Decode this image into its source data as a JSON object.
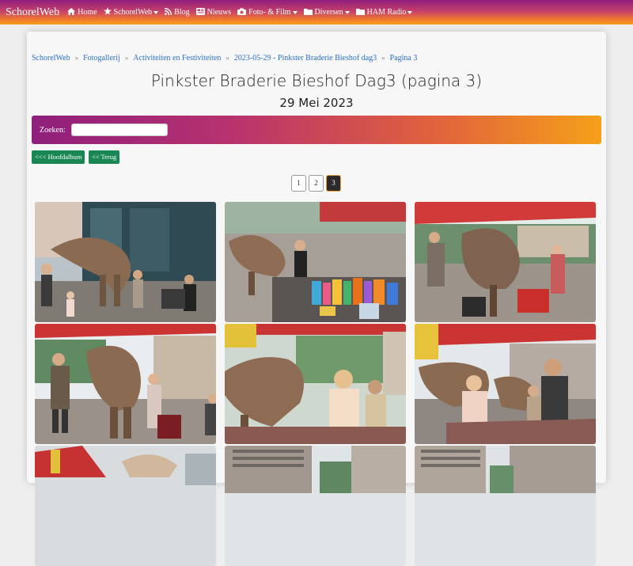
{
  "navbar": {
    "brand": "SchorelWeb",
    "items": [
      {
        "label": "Home",
        "icon": "home-icon",
        "dropdown": false
      },
      {
        "label": "SchorelWeb",
        "icon": "star-icon",
        "dropdown": true
      },
      {
        "label": "Blog",
        "icon": "rss-icon",
        "dropdown": false
      },
      {
        "label": "Nieuws",
        "icon": "newspaper-icon",
        "dropdown": false
      },
      {
        "label": "Foto- & Film",
        "icon": "camera-icon",
        "dropdown": true
      },
      {
        "label": "Diversen",
        "icon": "folder-icon",
        "dropdown": true
      },
      {
        "label": "HAM Radio",
        "icon": "folder-icon",
        "dropdown": true
      }
    ]
  },
  "breadcrumb": [
    "SchorelWeb",
    "Fotogallerij",
    "Activiteiten en Festiviteiten",
    "2023-05-29 - Pinkster Braderie Bieshof dag3",
    "Pagina 3"
  ],
  "page": {
    "title": "Pinkster Braderie Bieshof Dag3 (pagina 3)",
    "subtitle": "29 Mei 2023"
  },
  "search": {
    "label": "Zoeken:",
    "value": "",
    "placeholder": ""
  },
  "buttons": {
    "main_album": "<<< Hoofdalbum",
    "back": "<< Terug"
  },
  "pagination": {
    "pages": [
      "1",
      "2",
      "3"
    ],
    "current": "3"
  },
  "gallery": {
    "photos": [
      {
        "subject": "dinosaur-costume-crowd"
      },
      {
        "subject": "dinosaur-market-stall"
      },
      {
        "subject": "dinosaur-awning"
      },
      {
        "subject": "dinosaur-with-handler"
      },
      {
        "subject": "dinosaur-with-woman"
      },
      {
        "subject": "dinosaur-with-man"
      },
      {
        "subject": "flags-partial"
      },
      {
        "subject": "buildings-partial"
      },
      {
        "subject": "buildings-partial"
      }
    ]
  },
  "colors": {
    "nav_gradient_start": "#8e1f7c",
    "nav_gradient_end": "#f5a01a",
    "link": "#2a6fc9",
    "button_green": "#198754"
  }
}
